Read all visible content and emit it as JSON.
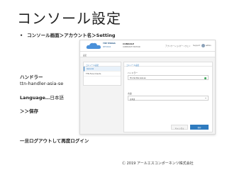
{
  "slide": {
    "title": "コンソール設定",
    "bullet": "コンソール画面＞アカウント名＞Setting",
    "annotations": {
      "handler_label": "ハンドラー",
      "handler_value": "ttn-handler-asia-se",
      "language_label": "Language…",
      "language_value": "日本語",
      "save": "＞＞保存"
    },
    "note": "一旦ログアウトして再度ログイン",
    "copyright": "Ⓒ 2019 アールエスコンポーネンツ株式会社"
  },
  "console": {
    "brand_line1": "THE THINGS",
    "brand_line2": "NETWORK",
    "title": "CONSOLE",
    "subtitle": "COMMUNITY EDITION",
    "nav": [
      "アプリケーション",
      "ゲートウェイ",
      "Support"
    ],
    "user": "admin",
    "breadcrumb": "設定",
    "side_header": "コンソール設定",
    "side_items": [
      "General",
      "TTN Fans Clients"
    ],
    "main_header": "コンソール設定",
    "handler_label": "ハンドラー",
    "handler_value": "ttn-handler-asia-se",
    "language_label": "言語",
    "language_value": "日本語",
    "cancel_label": "キャンセル",
    "save_label": "保存"
  },
  "colors": {
    "accent": "#2f7bbf",
    "success": "#3aa657"
  }
}
